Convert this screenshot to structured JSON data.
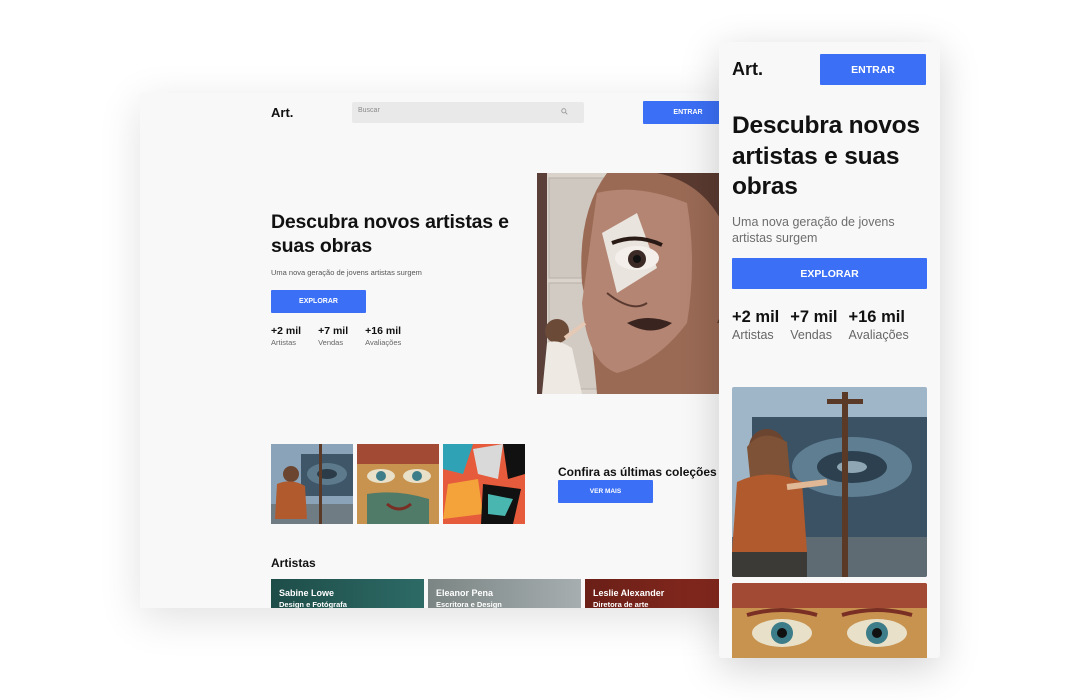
{
  "brand": {
    "logo": "Art.",
    "accent": "#3b6ff5"
  },
  "desktop": {
    "header": {
      "search_placeholder": "Buscar",
      "enter_label": "ENTRAR"
    },
    "hero": {
      "title": "Descubra novos artistas e suas obras",
      "subtitle": "Uma nova geração de jovens artistas surgem",
      "explore_label": "EXPLORAR",
      "stats": [
        {
          "value": "+2 mil",
          "label": "Artistas"
        },
        {
          "value": "+7 mil",
          "label": "Vendas"
        },
        {
          "value": "+16 mil",
          "label": "Avaliações"
        }
      ]
    },
    "collections": {
      "title": "Confira as últimas coleções",
      "button_label": "VER MAIS"
    },
    "artists": {
      "title": "Artistas",
      "cards": [
        {
          "name": "Sabine Lowe",
          "role": "Design e Fotógrafa"
        },
        {
          "name": "Eleanor Pena",
          "role": "Escritora e Design"
        },
        {
          "name": "Leslie Alexander",
          "role": "Diretora de arte"
        }
      ]
    }
  },
  "mobile": {
    "header": {
      "enter_label": "ENTRAR"
    },
    "hero": {
      "title": "Descubra novos artistas e suas obras",
      "subtitle": "Uma nova geração de jovens artistas surgem",
      "explore_label": "EXPLORAR",
      "stats": [
        {
          "value": "+2 mil",
          "label": "Artistas"
        },
        {
          "value": "+7 mil",
          "label": "Vendas"
        },
        {
          "value": "+16 mil",
          "label": "Avaliações"
        }
      ]
    }
  }
}
